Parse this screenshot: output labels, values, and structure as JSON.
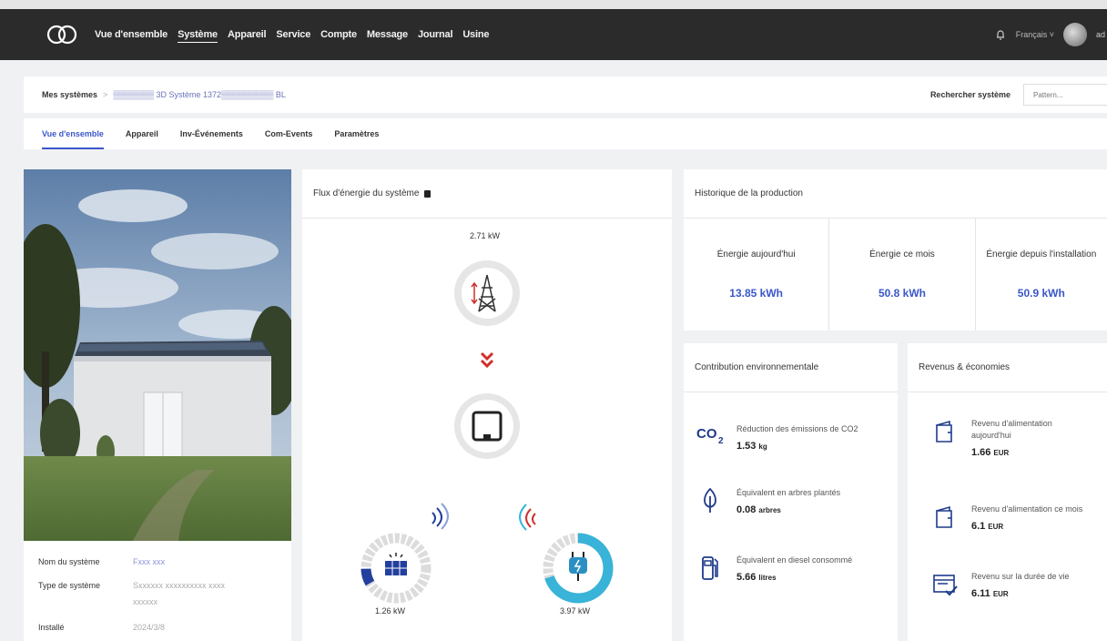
{
  "nav": {
    "items": [
      "Vue d'ensemble",
      "Système",
      "Appareil",
      "Service",
      "Compte",
      "Message",
      "Journal",
      "Usine"
    ],
    "active_index": 1
  },
  "topbar": {
    "language": "Français ˅",
    "avatar_label": "ad"
  },
  "breadcrumb": {
    "root": "Mes systèmes",
    "separator": ">",
    "current": "▒▒▒▒▒▒▒ 3D Système 1372▒▒▒▒▒▒▒▒▒ BL"
  },
  "search": {
    "label": "Rechercher système",
    "placeholder": "Pattern..."
  },
  "tabs": [
    "Vue d'ensemble",
    "Appareil",
    "Inv-Événements",
    "Com-Events",
    "Paramètres"
  ],
  "system_info": {
    "name_label": "Nom du système",
    "name_value": "Fxxx xxx",
    "type_label": "Type de système",
    "type_value_line1": "Sxxxxxx xxxxxxxxxx xxxx",
    "type_value_line2": "xxxxxx",
    "installed_label": "Installé",
    "installed_value": "2024/3/8"
  },
  "energy_flow": {
    "title": "Flux d'énergie du système",
    "grid_kw": "2.71 kW",
    "solar_kw": "1.26 kW",
    "load_kw": "3.97 kW",
    "solar_level": 0.08,
    "load_level": 0.7
  },
  "production": {
    "title": "Historique de la production",
    "stats": [
      {
        "label": "Énergie aujourd'hui",
        "value": "13.85 kWh"
      },
      {
        "label": "Énergie ce mois",
        "value": "50.8 kWh"
      },
      {
        "label": "Énergie depuis l'installation",
        "value": "50.9 kWh"
      }
    ]
  },
  "environment": {
    "title": "Contribution environnementale",
    "items": [
      {
        "icon": "co2-icon",
        "label": "Réduction des émissions de CO2",
        "value": "1.53",
        "unit": "kg"
      },
      {
        "icon": "leaf-icon",
        "label": "Équivalent en arbres plantés",
        "value": "0.08",
        "unit": "arbres"
      },
      {
        "icon": "fuel-pump-icon",
        "label": "Équivalent en diesel consommé",
        "value": "5.66",
        "unit": "litres"
      }
    ]
  },
  "revenue": {
    "title": "Revenus & économies",
    "items": [
      {
        "icon": "wallet-icon",
        "label_line1": "Revenu d'alimentation",
        "label_line2": "aujourd'hui",
        "value": "1.66",
        "unit": "EUR"
      },
      {
        "icon": "wallet-icon",
        "label_line1": "Revenu d'alimentation ce mois",
        "label_line2": "",
        "value": "6.1",
        "unit": "EUR"
      },
      {
        "icon": "calendar-check-icon",
        "label_line1": "Revenu sur la durée de vie",
        "label_line2": "",
        "value": "6.11",
        "unit": "EUR"
      }
    ]
  },
  "colors": {
    "accent": "#3b57c9",
    "topbar": "#2b2b2b",
    "flow_red": "#d0302c",
    "solar_blue": "#233f9e",
    "load_cyan": "#39b3d8"
  }
}
